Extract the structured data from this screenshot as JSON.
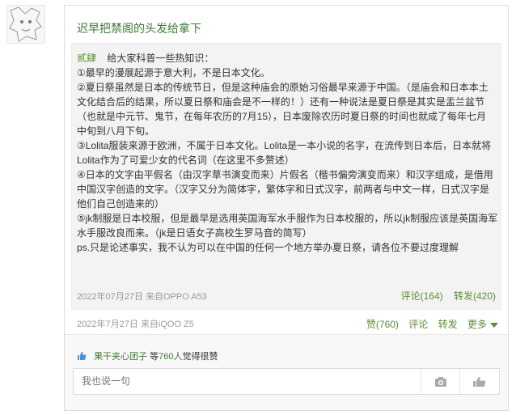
{
  "post": {
    "title": "迟早把禁阁的头发给拿下",
    "quote_author": "贰肆",
    "quote_lines": [
      "给大家科普一些热知识：",
      "①最早的漫展起源于意大利，不是日本文化。",
      "②夏日祭虽然是日本的传统节日，但是这种庙会的原始习俗最早来源于中国。（是庙会和日本本土",
      "文化结合后的结果，所以夏日祭和庙会是不一样的！）还有一种说法是夏日祭是其实是盂兰盆节",
      "（也就是中元节、鬼节，在每年农历的7月15），日本废除农历时夏日祭的时间也就成了每年七月",
      "中旬到八月下旬。",
      "③Lolita服装来源于欧洲，不属于日本文化。Lolita是一本小说的名字，在流传到日本后，日本就将",
      "Lolita作为了可爱少女的代名词（在这里不多赘述）",
      "④日本的文字由平假名（由汉字草书演变而来）片假名（楷书偏旁演变而来）和汉字组成，是借用",
      "中国汉字创造的文字。（汉字又分为简体字，繁体字和日式汉字，前两者与中文一样，日式汉字是",
      "他们自己创造来的）",
      "⑤jk制服是日本校服，但是最早是选用英国海军水手服作为日本校服的，所以jk制服应该是英国海军",
      "水手服改良而来。（jk是日语女子高校生罗马音的简写）",
      "ps.只是论述事实，我不认为可以在中国的任何一个地方举办夏日祭，请各位不要过度理解"
    ],
    "quote_meta": "2022年07月27日   来自OPPO A53",
    "quote_comment": "评论(164)",
    "quote_repost": "转发(420)",
    "meta": "2022年7月27日   来自iQOO Z5",
    "like_label": "赞(760)",
    "comment_label": "评论",
    "repost_label": "转发",
    "more_label": "更多"
  },
  "likes": {
    "user": "果干夹心团子",
    "text_pre": "等",
    "count": "760人",
    "text_post": "觉得很赞"
  },
  "reply": {
    "placeholder": "我也说一句"
  },
  "colors": {
    "accent_green": "#5e8c35",
    "title_green": "#3d7a33",
    "like_blue": "#4a90e2"
  },
  "icons": [
    "avatar",
    "thumbs-up-icon",
    "camera-icon",
    "like-hand-icon",
    "caret-down-icon"
  ]
}
